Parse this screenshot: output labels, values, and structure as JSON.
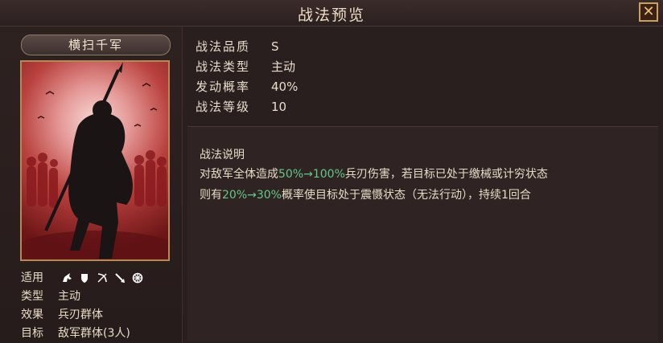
{
  "window": {
    "title": "战法预览",
    "close_label": "✕"
  },
  "skill": {
    "name": "横扫千军"
  },
  "attributes": {
    "applicable_label": "适用",
    "applicable_icons": [
      "cavalry-icon",
      "shield-icon",
      "bow-icon",
      "spear-icon",
      "wheel-icon"
    ],
    "type_label": "类型",
    "type_value": "主动",
    "effect_label": "效果",
    "effect_value": "兵刃群体",
    "target_label": "目标",
    "target_value": "敌军群体(3人)"
  },
  "stats": [
    {
      "label": "战法品质",
      "value": "S"
    },
    {
      "label": "战法类型",
      "value": "主动"
    },
    {
      "label": "发动概率",
      "value": "40%"
    },
    {
      "label": "战法等级",
      "value": "10"
    }
  ],
  "description": {
    "title": "战法说明",
    "line1": {
      "a": "对敌军全体造成",
      "b": "50%→100%",
      "c": "兵刃伤害，若目标已处于缴械或计穷状态"
    },
    "line2": {
      "a": "则有",
      "b": "20%→30%",
      "c": "概率使目标处于震慑状态（无法行动），持续1回合"
    }
  },
  "colors": {
    "highlight": "#64c88a",
    "frame": "#b58a54",
    "card_red": "#b9413e"
  }
}
